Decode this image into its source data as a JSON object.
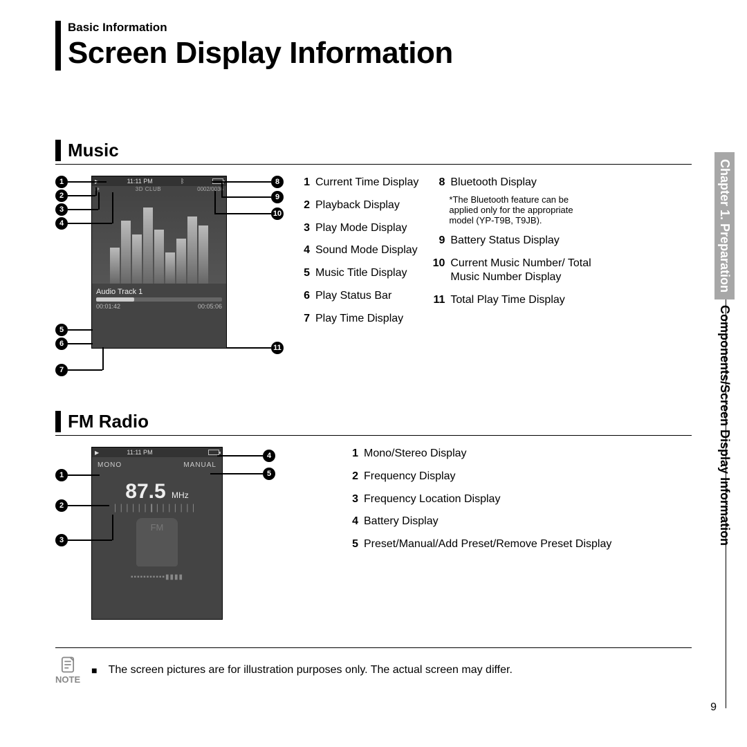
{
  "header": {
    "breadcrumb": "Basic Information",
    "title": "Screen Display Information"
  },
  "sidetab": {
    "chapter": "Chapter 1. Preparation",
    "path": "Components/Screen Display Information"
  },
  "sections": {
    "music": {
      "heading": "Music",
      "screen": {
        "time": "11:11 PM",
        "mode_text": "3D CLUB",
        "counter": "0002/0036",
        "track_title": "Audio Track 1",
        "play_time": "00:01:42",
        "total_time": "00:05:06"
      },
      "callouts_left": [
        "1",
        "2",
        "3",
        "4",
        "5",
        "6",
        "7"
      ],
      "callouts_right": [
        "8",
        "9",
        "10",
        "11"
      ],
      "legend_left": [
        {
          "n": "1",
          "t": "Current Time Display"
        },
        {
          "n": "2",
          "t": "Playback Display"
        },
        {
          "n": "3",
          "t": "Play Mode Display"
        },
        {
          "n": "4",
          "t": "Sound Mode Display"
        },
        {
          "n": "5",
          "t": "Music Title Display"
        },
        {
          "n": "6",
          "t": "Play Status Bar"
        },
        {
          "n": "7",
          "t": "Play Time Display"
        }
      ],
      "legend_right": [
        {
          "n": "8",
          "t": "Bluetooth Display"
        },
        {
          "n": "9",
          "t": "Battery Status Display"
        },
        {
          "n": "10",
          "t": "Current Music Number/ Total Music Number Display"
        },
        {
          "n": "11",
          "t": "Total Play Time Display"
        }
      ],
      "bt_note_star": "*",
      "bt_note": "The Bluetooth feature can be applied only for the appropriate model (YP-T9B, T9JB)."
    },
    "radio": {
      "heading": "FM Radio",
      "screen": {
        "time": "11:11 PM",
        "mono": "MONO",
        "mode": "MANUAL",
        "freq": "87.5",
        "unit": "MHz"
      },
      "callouts_left": [
        "1",
        "2",
        "3"
      ],
      "callouts_right": [
        "4",
        "5"
      ],
      "legend": [
        {
          "n": "1",
          "t": "Mono/Stereo Display"
        },
        {
          "n": "2",
          "t": "Frequency Display"
        },
        {
          "n": "3",
          "t": "Frequency Location Display"
        },
        {
          "n": "4",
          "t": "Battery Display"
        },
        {
          "n": "5",
          "t": "Preset/Manual/Add Preset/Remove Preset Display"
        }
      ]
    }
  },
  "note": {
    "label": "NOTE",
    "bullet": "■",
    "text": "The screen pictures are for illustration purposes only. The actual screen may differ."
  },
  "page_number": "9"
}
